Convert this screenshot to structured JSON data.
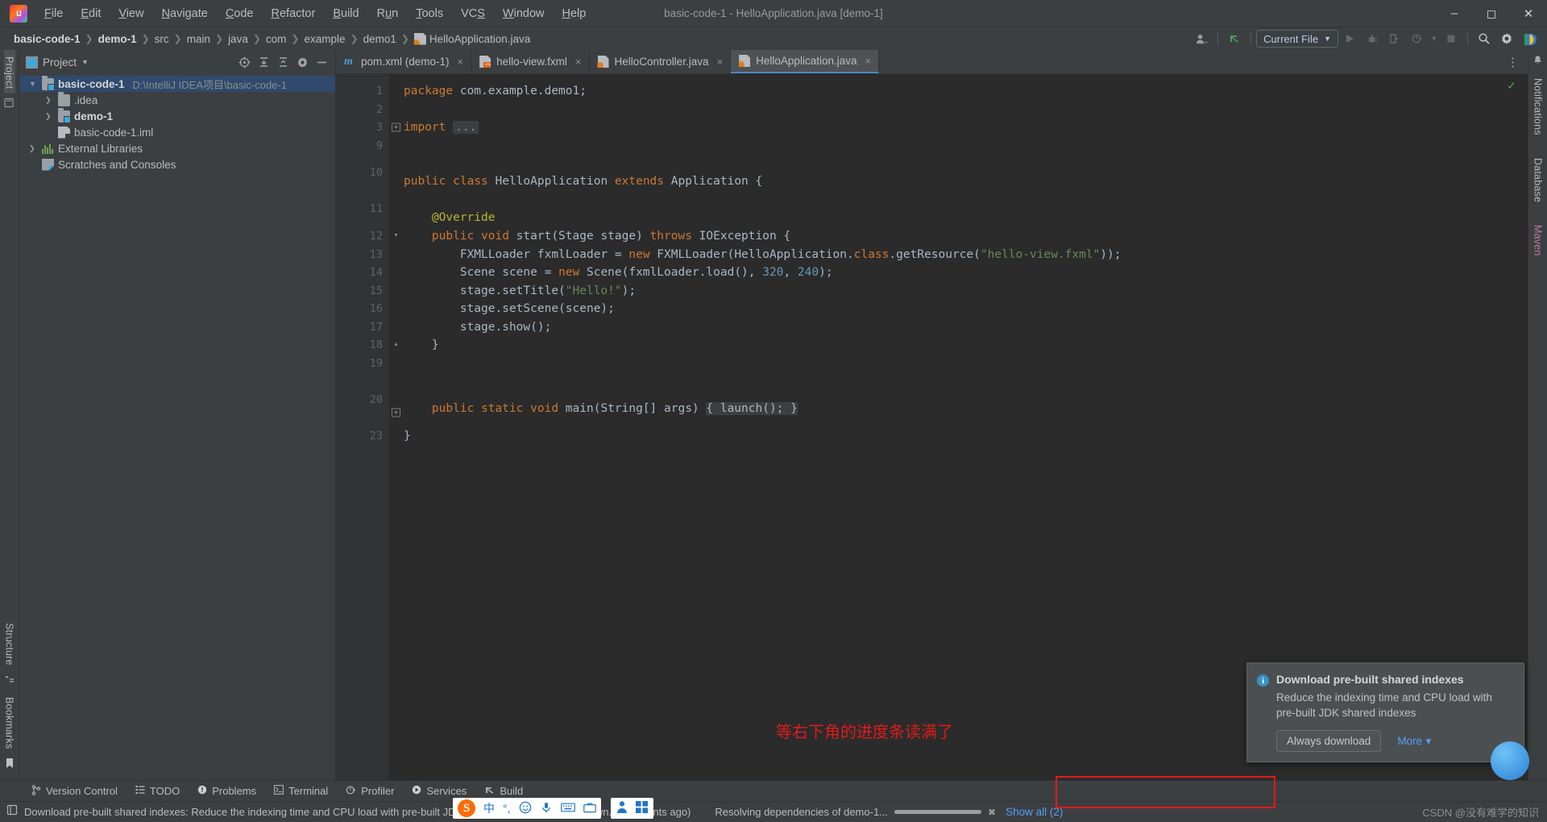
{
  "window": {
    "title": "basic-code-1 - HelloApplication.java [demo-1]",
    "logo_icon": "intellij-idea-logo",
    "minimize_icon": "minimize-icon",
    "maximize_icon": "maximize-icon",
    "close_icon": "close-icon"
  },
  "menubar": [
    {
      "label": "File"
    },
    {
      "label": "Edit"
    },
    {
      "label": "View"
    },
    {
      "label": "Navigate"
    },
    {
      "label": "Code"
    },
    {
      "label": "Refactor"
    },
    {
      "label": "Build"
    },
    {
      "label": "Run"
    },
    {
      "label": "Tools"
    },
    {
      "label": "VCS"
    },
    {
      "label": "Window"
    },
    {
      "label": "Help"
    }
  ],
  "breadcrumbs": [
    {
      "label": "basic-code-1",
      "bold": true
    },
    {
      "label": "demo-1",
      "bold": true
    },
    {
      "label": "src",
      "bold": false
    },
    {
      "label": "main",
      "bold": false
    },
    {
      "label": "java",
      "bold": false
    },
    {
      "label": "com",
      "bold": false
    },
    {
      "label": "example",
      "bold": false
    },
    {
      "label": "demo1",
      "bold": false
    },
    {
      "label": "HelloApplication.java",
      "bold": false,
      "icon": "java-file-icon"
    }
  ],
  "toolbar": {
    "account_icon": "account-icon",
    "updates_icon": "green-arrow-icon",
    "run_config": "Current File",
    "run_icon": "run-icon",
    "debug_icon": "debug-icon",
    "run_coverage_icon": "run-with-coverage-icon",
    "profile_icon": "profiler-icon",
    "stop_icon": "stop-icon",
    "search_icon": "search-everywhere-icon",
    "settings_icon": "settings-gear-icon",
    "plugin_icon": "ide-plugin-icon"
  },
  "left_rail": {
    "project_label": "Project",
    "structure_label": "Structure",
    "bookmarks_label": "Bookmarks",
    "commit_icon": "commit-icon",
    "bookmark_icon": "bookmark-icon"
  },
  "right_rail": {
    "notifications_label": "Notifications",
    "database_label": "Database",
    "maven_label": "Maven"
  },
  "project_panel": {
    "title": "Project",
    "dropdown_icon": "chevron-down-icon",
    "locate_icon": "select-opened-file-icon",
    "expand_icon": "expand-all-icon",
    "collapse_icon": "collapse-all-icon",
    "settings_icon": "gear-icon",
    "hide_icon": "hide-panel-icon",
    "tree": [
      {
        "label": "basic-code-1",
        "path": "D:\\IntelliJ IDEA项目\\basic-code-1",
        "icon": "module-folder-icon",
        "arrow": "expanded",
        "indent": 0,
        "bold": true,
        "selected": true
      },
      {
        "label": ".idea",
        "path": "",
        "icon": "folder-icon",
        "arrow": "collapsed",
        "indent": 1,
        "bold": false,
        "selected": false
      },
      {
        "label": "demo-1",
        "path": "",
        "icon": "module-folder-icon",
        "arrow": "collapsed",
        "indent": 1,
        "bold": true,
        "selected": false
      },
      {
        "label": "basic-code-1.iml",
        "path": "",
        "icon": "iml-file-icon",
        "arrow": "none",
        "indent": 1,
        "bold": false,
        "selected": false
      },
      {
        "label": "External Libraries",
        "path": "",
        "icon": "libraries-icon",
        "arrow": "collapsed",
        "indent": 0,
        "bold": false,
        "selected": false
      },
      {
        "label": "Scratches and Consoles",
        "path": "",
        "icon": "scratches-icon",
        "arrow": "none",
        "indent": 0,
        "bold": false,
        "selected": false
      }
    ]
  },
  "editor_tabs": [
    {
      "label": "pom.xml (demo-1)",
      "icon": "maven-file-icon",
      "active": false,
      "close": "×"
    },
    {
      "label": "hello-view.fxml",
      "icon": "fxml-file-icon",
      "active": false,
      "close": "×"
    },
    {
      "label": "HelloController.java",
      "icon": "java-file-icon",
      "active": false,
      "close": "×"
    },
    {
      "label": "HelloApplication.java",
      "icon": "java-file-icon",
      "active": true,
      "close": "×"
    }
  ],
  "editor": {
    "more_icon": "more-options-icon",
    "inspection_status": "ok-check-icon",
    "line_numbers": [
      "1",
      "2",
      "3",
      "9",
      "10",
      "11",
      "12",
      "13",
      "14",
      "15",
      "16",
      "17",
      "18",
      "19",
      "20",
      "23"
    ],
    "code_lines": [
      {
        "num": "1",
        "text": "package com.example.demo1;"
      },
      {
        "num": "2",
        "text": ""
      },
      {
        "num": "3",
        "text": "import ..."
      },
      {
        "num": "9",
        "text": ""
      },
      {
        "num": "10",
        "text": "public class HelloApplication extends Application {"
      },
      {
        "num": "11",
        "text": "    @Override"
      },
      {
        "num": "12",
        "text": "    public void start(Stage stage) throws IOException {"
      },
      {
        "num": "13",
        "text": "        FXMLLoader fxmlLoader = new FXMLLoader(HelloApplication.class.getResource(\"hello-view.fxml\"));"
      },
      {
        "num": "14",
        "text": "        Scene scene = new Scene(fxmlLoader.load(), 320, 240);"
      },
      {
        "num": "15",
        "text": "        stage.setTitle(\"Hello!\");"
      },
      {
        "num": "16",
        "text": "        stage.setScene(scene);"
      },
      {
        "num": "17",
        "text": "        stage.show();"
      },
      {
        "num": "18",
        "text": "    }"
      },
      {
        "num": "19",
        "text": ""
      },
      {
        "num": "20",
        "text": "    public static void main(String[] args) { launch(); }"
      },
      {
        "num": "23",
        "text": "}"
      }
    ]
  },
  "annotation": {
    "text": "等右下角的进度条读满了",
    "color": "#e01b1b"
  },
  "notification": {
    "icon": "info-icon",
    "title": "Download pre-built shared indexes",
    "body": "Reduce the indexing time and CPU load with pre-built JDK shared indexes",
    "primary_button": "Always download",
    "more_link": "More",
    "more_caret": "▾"
  },
  "bottom_tabs": [
    {
      "label": "Version Control",
      "icon": "branch-icon"
    },
    {
      "label": "TODO",
      "icon": "todo-icon"
    },
    {
      "label": "Problems",
      "icon": "problems-icon"
    },
    {
      "label": "Terminal",
      "icon": "terminal-icon"
    },
    {
      "label": "Profiler",
      "icon": "profiler-icon"
    },
    {
      "label": "Services",
      "icon": "services-icon"
    },
    {
      "label": "Build",
      "icon": "build-icon"
    }
  ],
  "statusbar": {
    "event_icon": "event-log-icon",
    "message": "Download pre-built shared indexes: Reduce the indexing time and CPU load with pre-built JDK shared indexes // Always down... (moments ago)",
    "task": "Resolving dependencies of demo-1...",
    "progress_percent": 100,
    "cancel_icon": "cancel-icon",
    "show_all": "Show all (2)",
    "watermark": "CSDN @没有难学的知识"
  },
  "ime": {
    "logo": "S",
    "mode": "中",
    "punct": "°,",
    "emoji_icon": "emoji-icon",
    "mic_icon": "microphone-icon",
    "keyboard_icon": "keyboard-icon",
    "toolbox_icon": "toolbox-icon"
  },
  "colors": {
    "accent": "#4a88c7",
    "keyword": "#cc7832",
    "string": "#6a8759",
    "number": "#6897bb",
    "editor_bg": "#2b2b2b",
    "panel_bg": "#3c3f41",
    "annotation_red": "#e01b1b"
  }
}
